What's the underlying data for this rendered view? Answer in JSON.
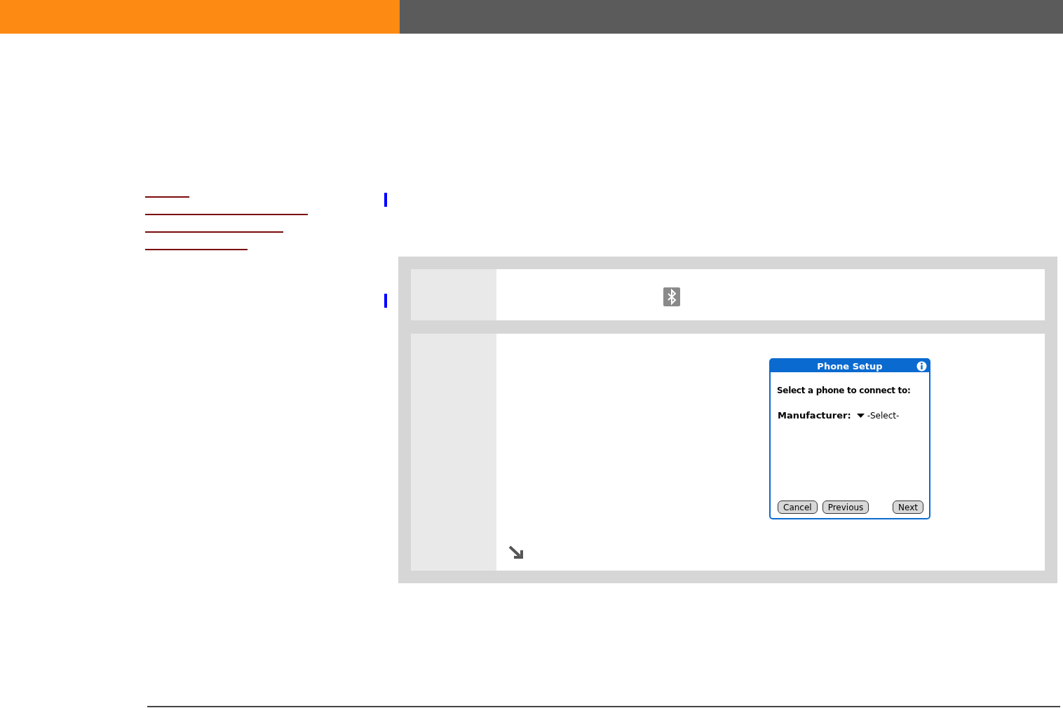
{
  "phone_screen": {
    "title": "Phone Setup",
    "prompt": "Select a phone to connect to:",
    "manufacturer_label": "Manufacturer:",
    "manufacturer_value": "-Select-",
    "left_buttons": [
      "Cancel",
      "Previous"
    ],
    "right_buttons": [
      "Next"
    ]
  }
}
